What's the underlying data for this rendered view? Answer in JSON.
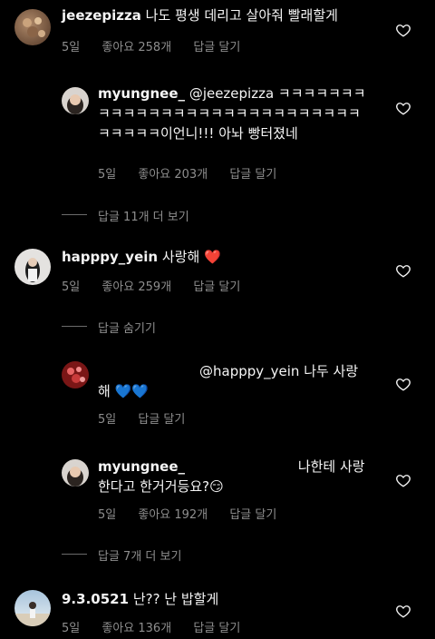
{
  "comments": [
    {
      "username": "jeezepizza",
      "text": "나도 평생 데리고 살아줘 빨래할게",
      "time": "5일",
      "likes": "좋아요 258개",
      "reply": "답글 달기"
    },
    {
      "username": "myungnee_",
      "text": "@jeezepizza ㅋㅋㅋㅋㅋㅋㅋㅋㅋㅋㅋㅋㅋㅋㅋㅋㅋㅋㅋㅋㅋㅋㅋㅋㅋㅋㅋㅋㅋㅋㅋㅋㅋ이언니!!! 아놔 빵터졌네",
      "time": "5일",
      "likes": "좋아요 203개",
      "reply": "답글 달기"
    },
    {
      "username": "happpy_yein",
      "text": "사랑해 ❤️",
      "time": "5일",
      "likes": "좋아요 259개",
      "reply": "답글 달기"
    },
    {
      "username": "",
      "text": "@happpy_yein 나두 사랑해 💙💙",
      "time": "5일",
      "reply": "답글 달기"
    },
    {
      "username": "myungnee_",
      "text": "나한테 사랑한다고 한거거등요?😏",
      "time": "5일",
      "likes": "좋아요 192개",
      "reply": "답글 달기"
    },
    {
      "username": "9.3.0521",
      "text": "난?? 난 밥할게",
      "time": "5일",
      "likes": "좋아요 136개",
      "reply": "답글 달기"
    }
  ],
  "threads": {
    "view_more_1": "답글 11개 더 보기",
    "hide_replies": "답글 숨기기",
    "view_more_2": "답글 7개 더 보기"
  },
  "icons": {
    "heart": "heart-outline-icon"
  },
  "colors": {
    "background": "#000000",
    "text": "#f5f5f5",
    "meta": "#8e8e8e"
  }
}
